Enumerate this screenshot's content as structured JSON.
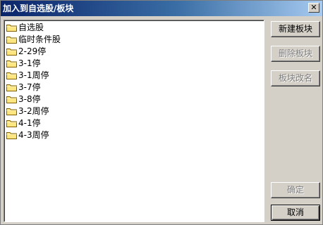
{
  "window": {
    "title": "加入到自选股/板块",
    "close_glyph": "✕"
  },
  "list": {
    "items": [
      {
        "label": "自选股"
      },
      {
        "label": "临时条件股"
      },
      {
        "label": "2-29停"
      },
      {
        "label": "3-1停"
      },
      {
        "label": "3-1周停"
      },
      {
        "label": "3-7停"
      },
      {
        "label": "3-8停"
      },
      {
        "label": "3-2周停"
      },
      {
        "label": "4-1停"
      },
      {
        "label": "4-3周停"
      }
    ]
  },
  "buttons": {
    "new_block": "新建板块",
    "delete_block": "删除板块",
    "rename_block": "板块改名",
    "confirm": "确定",
    "cancel": "取消"
  },
  "colors": {
    "folder_fill": "#ffe680",
    "folder_stroke": "#806000",
    "titlebar_start": "#0a246a",
    "dialog_bg": "#d4d0c8"
  },
  "icons": {
    "folder": "folder-icon",
    "close": "close-icon"
  }
}
